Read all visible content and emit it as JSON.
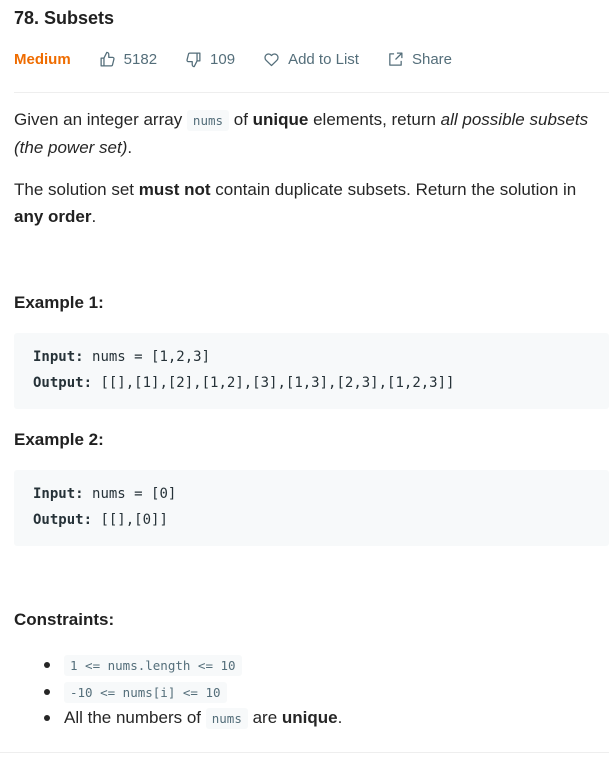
{
  "problem": {
    "title": "78. Subsets",
    "difficulty": "Medium",
    "likes": "5182",
    "dislikes": "109",
    "add_to_list": "Add to List",
    "share": "Share",
    "icons": {
      "like": "thumbs-up-icon",
      "dislike": "thumbs-down-icon",
      "favorite": "heart-icon",
      "share": "share-icon"
    },
    "colors": {
      "difficulty": "#ef6c00",
      "meta": "#546e7a",
      "code_bg": "#f7f9fa"
    }
  },
  "description": {
    "p1": {
      "before": "Given an integer array ",
      "code": "nums",
      "mid1": " of ",
      "bold": "unique",
      "mid2": " elements, return ",
      "italic_line1": "all possible subsets",
      "italic_line2": "(the power set)",
      "end": "."
    },
    "p2": {
      "before": "The solution set ",
      "bold1": "must not",
      "mid": " contain duplicate subsets. Return the solution in",
      "bold2": "any order",
      "end": "."
    }
  },
  "examples": [
    {
      "heading": "Example 1:",
      "input_label": "Input:",
      "input_value": "nums = [1,2,3]",
      "output_label": "Output:",
      "output_value": "[[],[1],[2],[1,2],[3],[1,3],[2,3],[1,2,3]]"
    },
    {
      "heading": "Example 2:",
      "input_label": "Input:",
      "input_value": "nums = [0]",
      "output_label": "Output:",
      "output_value": "[[],[0]]"
    }
  ],
  "constraints": {
    "heading": "Constraints:",
    "item1": "1 <= nums.length <= 10",
    "item2": "-10 <= nums[i] <= 10",
    "item3_before": "All the numbers of ",
    "item3_code": "nums",
    "item3_mid": " are ",
    "item3_bold": "unique",
    "item3_end": "."
  }
}
